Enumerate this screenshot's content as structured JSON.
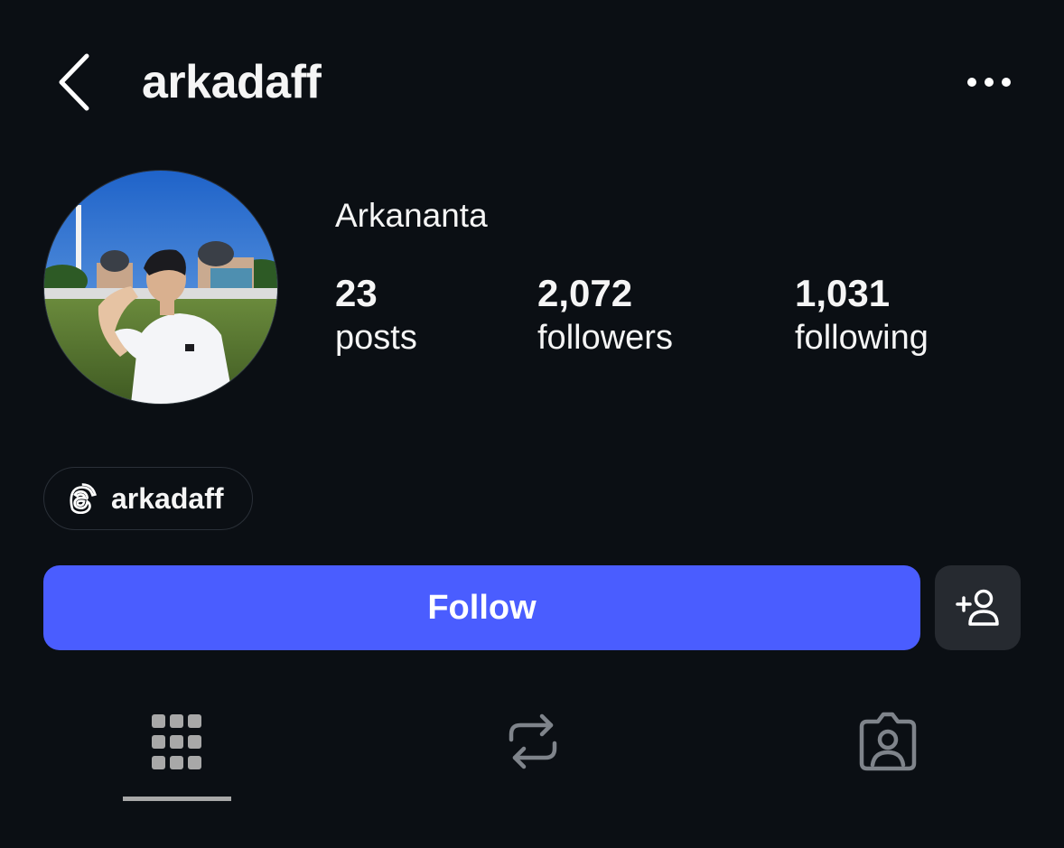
{
  "header": {
    "username": "arkadaff",
    "back_icon": "chevron-left-icon",
    "more_icon": "more-horizontal-icon"
  },
  "profile": {
    "display_name": "Arkananta",
    "stats": {
      "posts": {
        "value": "23",
        "label": "posts"
      },
      "followers": {
        "value": "2,072",
        "label": "followers"
      },
      "following": {
        "value": "1,031",
        "label": "following"
      }
    }
  },
  "threads_link": {
    "icon": "threads-icon",
    "label": "arkadaff"
  },
  "actions": {
    "follow_label": "Follow",
    "add_user_icon": "add-user-icon"
  },
  "tabs": {
    "active": "grid",
    "items": [
      "grid-icon",
      "repost-icon",
      "tagged-icon"
    ]
  },
  "colors": {
    "background": "#0b0f14",
    "accent": "#4a5dff",
    "secondary_button": "#262a30",
    "tab_icon": "#8a8f96"
  }
}
